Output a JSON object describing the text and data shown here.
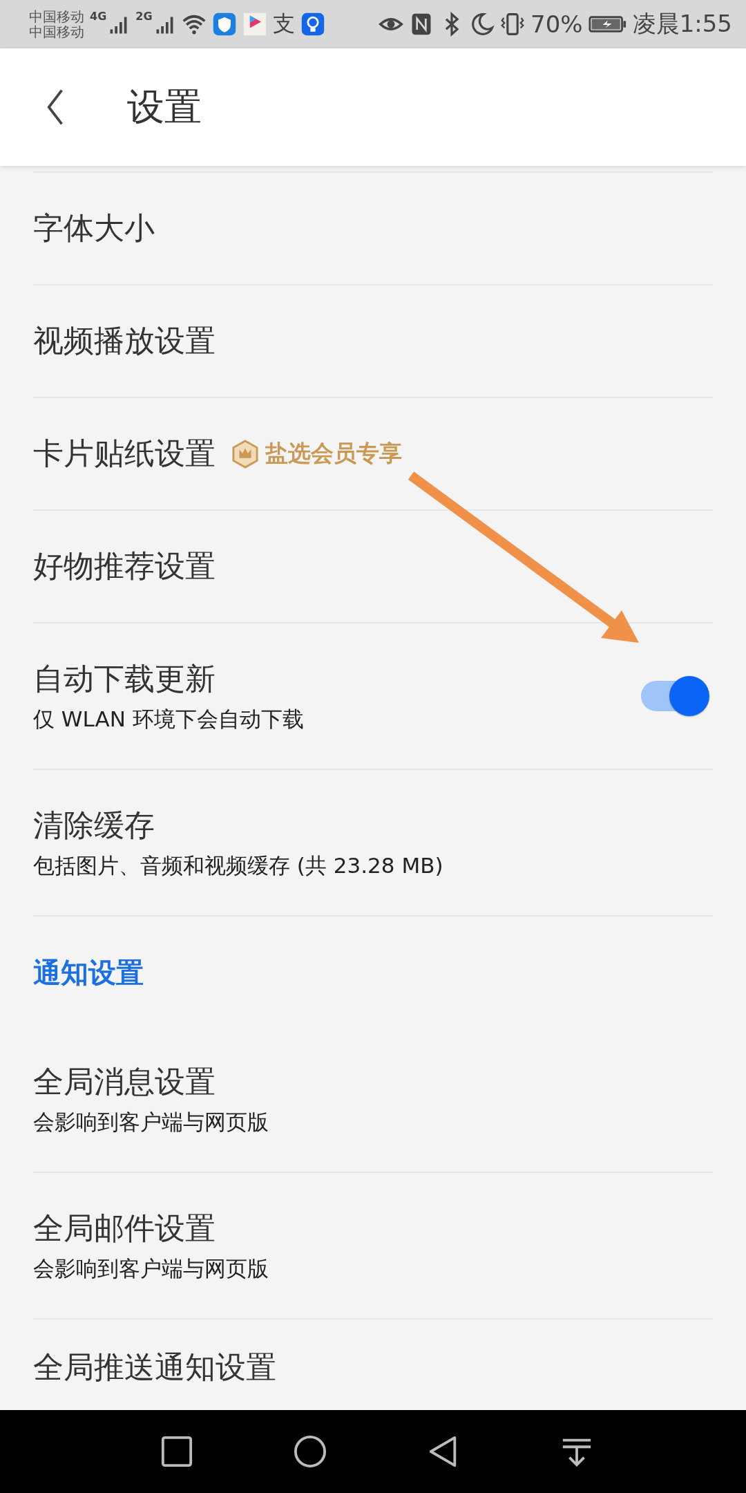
{
  "status_bar": {
    "carriers": [
      "中国移动",
      "中国移动"
    ],
    "networks": [
      "4G",
      "2G"
    ],
    "app_glyph": "支",
    "battery_percent": "70%",
    "time": "凌晨1:55"
  },
  "header": {
    "title": "设置"
  },
  "items": [
    {
      "kind": "plain",
      "title": "字体大小"
    },
    {
      "kind": "plain",
      "title": "视频播放设置"
    },
    {
      "kind": "badge",
      "title": "卡片贴纸设置",
      "badge": "盐选会员专享"
    },
    {
      "kind": "plain",
      "title": "好物推荐设置"
    },
    {
      "kind": "toggle",
      "title": "自动下载更新",
      "subtitle": "仅 WLAN 环境下会自动下载",
      "on": true
    },
    {
      "kind": "plain",
      "title": "清除缓存",
      "subtitle": "包括图片、音频和视频缓存 (共 23.28 MB)"
    },
    {
      "kind": "section",
      "title": "通知设置"
    },
    {
      "kind": "plain",
      "title": "全局消息设置",
      "subtitle": "会影响到客户端与网页版"
    },
    {
      "kind": "plain",
      "title": "全局邮件设置",
      "subtitle": "会影响到客户端与网页版"
    },
    {
      "kind": "plain",
      "title": "全局推送通知设置"
    }
  ]
}
